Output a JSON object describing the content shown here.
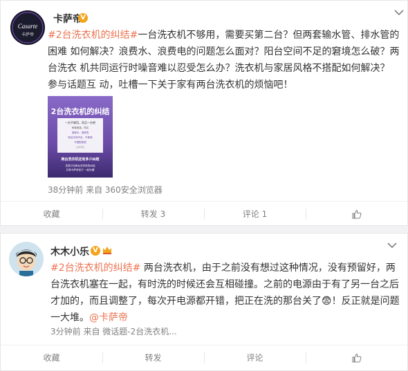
{
  "post1": {
    "user": "卡萨帝",
    "avatar_text": "Casarte",
    "avatar_sub": "卡萨帝",
    "text_segments": [
      {
        "t": "#2台洗衣机的纠结#",
        "type": "topic"
      },
      {
        "t": "一台洗衣机不够用，需要买第二台？但两套输水管、排水管的困难 如何解决？浪费水、浪费电的问题怎么面对？阳台空间不足的窘境怎么破？两台洗衣 机共同运行时噪音难以忍受怎么办？洗衣机与家居风格不搭配如何解决？ 参与话题互 动，吐槽一下关于家有两台洗衣机的烦恼吧！",
        "type": "text"
      }
    ],
    "image": {
      "title": "2台洗衣机的纠结",
      "lines": [
        "一台不够用，再买一台吧",
        "两套管道，再买",
        "浪费水，浪费电",
        "阳台空间不足，不美观",
        "不搭配家居",
        "全体家庭"
      ],
      "footer_title": "两台洗衣机还有多少纠结",
      "footer_lines": [
        "发表讨论两台洗衣机的纠结",
        "并带卡萨帝官方 一起吐槽"
      ]
    },
    "meta": "38分钟前 来自 360安全浏览器",
    "actions": [
      "收藏",
      "转发 3",
      "评论 1",
      ""
    ]
  },
  "post2": {
    "user": "木木小乐",
    "text_segments": [
      {
        "t": "#2台洗衣机的纠结#",
        "type": "topic"
      },
      {
        "t": " 两台洗衣机，由于之前没有想过这种情况，没有预留好，两台洗衣机塞在一起，有时洗的时候还会互相碰撞。之前的电源由于有了另一台之后才加的，而且调整了，每次开电源都开错，把正在洗的那台关了",
        "type": "text"
      },
      {
        "t": "😨",
        "type": "emoji"
      },
      {
        "t": "！反正就是问题一大堆。",
        "type": "text"
      },
      {
        "t": "@卡萨帝",
        "type": "mention"
      }
    ],
    "meta": "3分钟前 来自 微话题-2台洗衣机...",
    "actions": [
      "收藏",
      "转发",
      "评论",
      ""
    ]
  },
  "colors": {
    "topic": "#eb7350",
    "badge": "#f3a51a",
    "avatar_bg": "#1b1b2e",
    "image_bg": "#6a4aa6"
  }
}
